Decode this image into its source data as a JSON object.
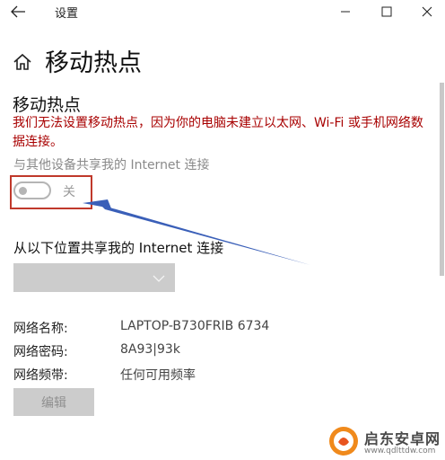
{
  "window": {
    "title": "设置",
    "icons": {
      "back": "back-arrow-icon",
      "minimize": "minimize-icon",
      "maximize": "maximize-icon",
      "close": "close-icon"
    }
  },
  "header": {
    "title": "移动热点",
    "icon": "home-icon"
  },
  "hotspot": {
    "section_title": "移动热点",
    "error_message": "我们无法设置移动热点，因为你的电脑未建立以太网、Wi-Fi 或手机网络数据连接。",
    "share_label": "与其他设备共享我的 Internet 连接",
    "toggle_state": "关",
    "toggle_on": false
  },
  "share_from": {
    "label": "从以下位置共享我的 Internet 连接",
    "selected": ""
  },
  "network": {
    "name_label": "网络名称:",
    "name_value": "LAPTOP-B730FRIB 6734",
    "password_label": "网络密码:",
    "password_value": "8A93|93k",
    "band_label": "网络频带:",
    "band_value": "任何可用频率"
  },
  "edit_button": "编辑",
  "watermark": {
    "name": "启东安卓网",
    "url": "www.qdlttdw.com"
  },
  "colors": {
    "error": "#a80000",
    "highlight_box": "#c0392b",
    "arrow": "#3a5fb8",
    "disabled": "#cccccc"
  }
}
